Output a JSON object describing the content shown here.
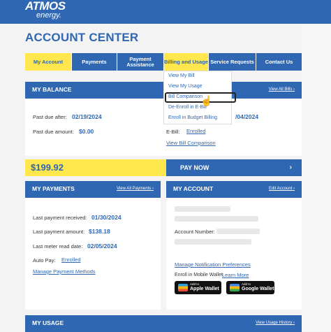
{
  "brand": {
    "name": "ATMOS",
    "sub": "energy."
  },
  "page_title": "ACCOUNT CENTER",
  "nav": [
    {
      "label": "My Account",
      "active": true
    },
    {
      "label": "Payments"
    },
    {
      "label": "Payment Assistance"
    },
    {
      "label": "Billing and Usage"
    },
    {
      "label": "Service Requests"
    },
    {
      "label": "Contact Us"
    }
  ],
  "billing_menu": [
    "View My Bill",
    "View My Usage",
    "Bill Comparison",
    "De-Enroll in E-Bill",
    "Enroll in Budget Billing"
  ],
  "balance": {
    "title": "MY BALANCE",
    "view_all": "View All Bills",
    "past_due_after_label": "Past due after:",
    "past_due_after": "02/19/2024",
    "past_due_amount_label": "Past due amount:",
    "past_due_amount": "$0.00",
    "right_date": "/04/2024",
    "ebill_label": "E-Bill:",
    "ebill_value": "Enrolled",
    "view_comparison": "View Bill Comparison",
    "amount": "$199.92",
    "pay_now": "PAY NOW"
  },
  "payments": {
    "title": "MY PAYMENTS",
    "view_all": "View All Payments",
    "last_received_label": "Last payment received:",
    "last_received": "01/30/2024",
    "last_amount_label": "Last payment amount:",
    "last_amount": "$138.18",
    "meter_label": "Last meter read date:",
    "meter_date": "02/05/2024",
    "autopay_label": "Auto Pay:",
    "autopay_value": "Enrolled",
    "manage_methods": "Manage Payment Methods"
  },
  "account": {
    "title": "MY ACCOUNT",
    "edit": "Edit Account",
    "account_number_label": "Account Number:",
    "manage_notifications": "Manage Notification Preferences",
    "wallet_text": "Enroll in Mobile Wallet",
    "learn_more": "Learn More",
    "apple_small": "Add to",
    "apple_big": "Apple Wallet",
    "google_small": "Add to",
    "google_big": "Google Wallet"
  },
  "usage": {
    "title": "MY USAGE",
    "view": "View Usage History"
  },
  "icons": {
    "chevron": "chevron-right-icon",
    "cursor": "hand-pointer-icon"
  },
  "colors": {
    "brand_blue": "#2f67b3",
    "accent_yellow": "#ffe74d"
  }
}
